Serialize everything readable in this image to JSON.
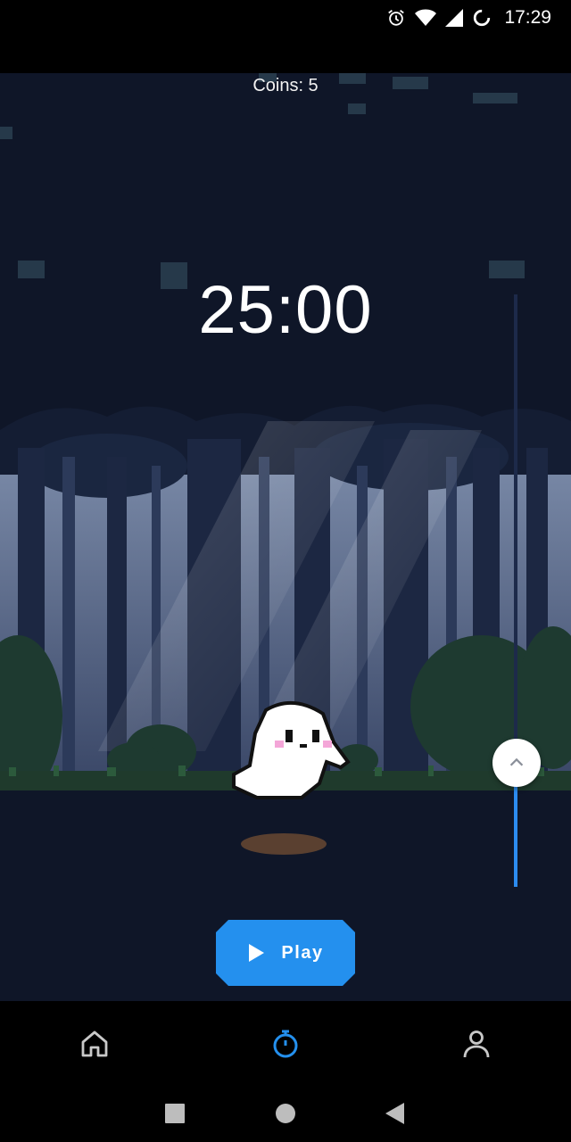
{
  "status_bar": {
    "time": "17:29",
    "icons": [
      "alarm-icon",
      "wifi-icon",
      "cellular-signal-icon",
      "battery-charging-icon"
    ]
  },
  "game": {
    "coins_text": "Coins: 5",
    "timer": "25:00",
    "progress_fraction": 0.17
  },
  "play_button": {
    "label": "Play",
    "icon": "play-icon"
  },
  "bottom_nav": {
    "items": [
      {
        "icon": "home-icon",
        "active": false
      },
      {
        "icon": "stopwatch-icon",
        "active": true
      },
      {
        "icon": "profile-icon",
        "active": false
      }
    ]
  },
  "system_nav": [
    "recents-icon",
    "home-circle-icon",
    "back-icon"
  ],
  "colors": {
    "accent": "#2490ee",
    "background": "#0f1628",
    "inactive_icon": "#c9c9c9"
  }
}
